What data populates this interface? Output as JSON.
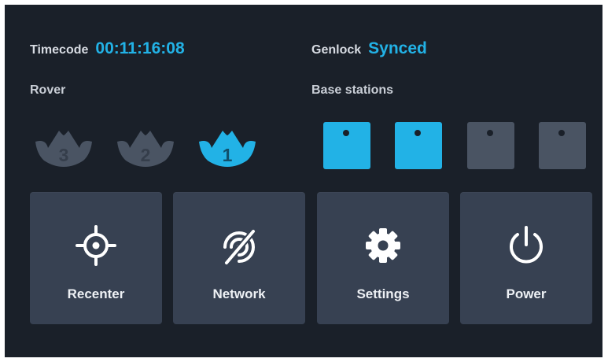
{
  "status": {
    "timecode": {
      "label": "Timecode",
      "value": "00:11:16:08"
    },
    "genlock": {
      "label": "Genlock",
      "value": "Synced"
    }
  },
  "sections": {
    "rover_label": "Rover",
    "base_stations_label": "Base stations"
  },
  "rovers": [
    {
      "number": "3",
      "active": false
    },
    {
      "number": "2",
      "active": false
    },
    {
      "number": "1",
      "active": true
    }
  ],
  "base_stations": [
    {
      "active": true
    },
    {
      "active": true
    },
    {
      "active": false
    },
    {
      "active": false
    }
  ],
  "actions": [
    {
      "label": "Recenter",
      "icon": "crosshair-icon"
    },
    {
      "label": "Network",
      "icon": "network-off-icon"
    },
    {
      "label": "Settings",
      "icon": "gear-icon"
    },
    {
      "label": "Power",
      "icon": "power-icon"
    }
  ],
  "colors": {
    "background": "#1a2029",
    "accent": "#22b2e6",
    "inactive": "#4a5463",
    "tile": "#374152",
    "text": "#eef1f5"
  }
}
